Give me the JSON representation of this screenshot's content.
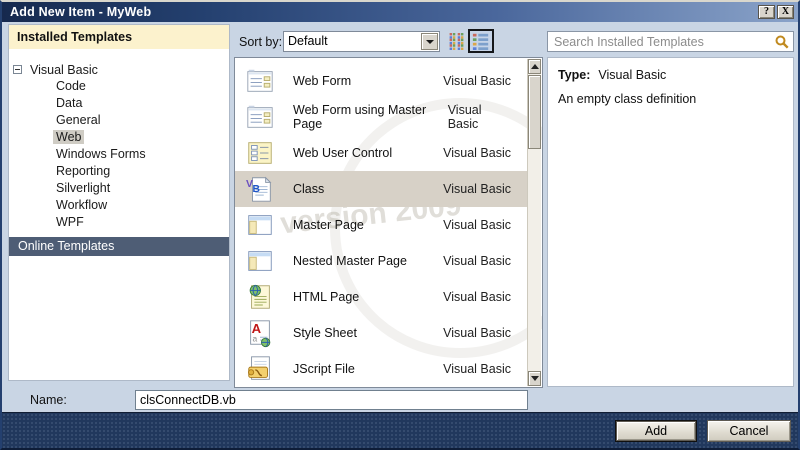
{
  "window": {
    "title": "Add New Item - MyWeb",
    "help_glyph": "?",
    "close_glyph": "X"
  },
  "left_panel": {
    "header": "Installed Templates",
    "tree": {
      "root": "Visual Basic",
      "children": [
        "Code",
        "Data",
        "General",
        "Web",
        "Windows Forms",
        "Reporting",
        "Silverlight",
        "Workflow",
        "WPF"
      ],
      "selected_child": "Web"
    },
    "online_header": "Online Templates"
  },
  "toolbar": {
    "sort_label": "Sort by:",
    "sort_value": "Default",
    "icons": [
      "medium-icons-view-icon",
      "list-view-icon"
    ]
  },
  "search": {
    "placeholder": "Search Installed Templates",
    "icon": "magnifier-icon"
  },
  "list": {
    "selected_item": "Class",
    "items": [
      {
        "name": "Web Form",
        "type": "Visual Basic",
        "icon": "webform-icon"
      },
      {
        "name": "Web Form using Master Page",
        "type": "Visual Basic",
        "icon": "webform-master-icon"
      },
      {
        "name": "Web User Control",
        "type": "Visual Basic",
        "icon": "web-user-control-icon"
      },
      {
        "name": "Class",
        "type": "Visual Basic",
        "icon": "vb-class-icon"
      },
      {
        "name": "Master Page",
        "type": "Visual Basic",
        "icon": "master-page-icon"
      },
      {
        "name": "Nested Master Page",
        "type": "Visual Basic",
        "icon": "nested-master-page-icon"
      },
      {
        "name": "HTML Page",
        "type": "Visual Basic",
        "icon": "html-page-icon"
      },
      {
        "name": "Style Sheet",
        "type": "Visual Basic",
        "icon": "style-sheet-icon"
      },
      {
        "name": "JScript File",
        "type": "Visual Basic",
        "icon": "jscript-file-icon"
      }
    ]
  },
  "info": {
    "type_label": "Type:",
    "type_value": "Visual Basic",
    "description": "An empty class definition"
  },
  "name_row": {
    "label": "Name:",
    "value": "clsConnectDB.vb"
  },
  "footer": {
    "add_label": "Add",
    "cancel_label": "Cancel"
  },
  "watermark": {
    "text": "version 2009"
  },
  "colors": {
    "titlebar_start": "#16294e",
    "titlebar_end": "#8aa3c9",
    "dialog_bg": "#c9d5e4",
    "panel_header_bg": "#fcf2cd",
    "online_bar_bg": "#4e5d75",
    "tree_selection_bg": "#cfccc4",
    "list_selection_bg": "#d7d1c7",
    "footer_bg": "#21385d",
    "search_icon": "#c08a20"
  }
}
